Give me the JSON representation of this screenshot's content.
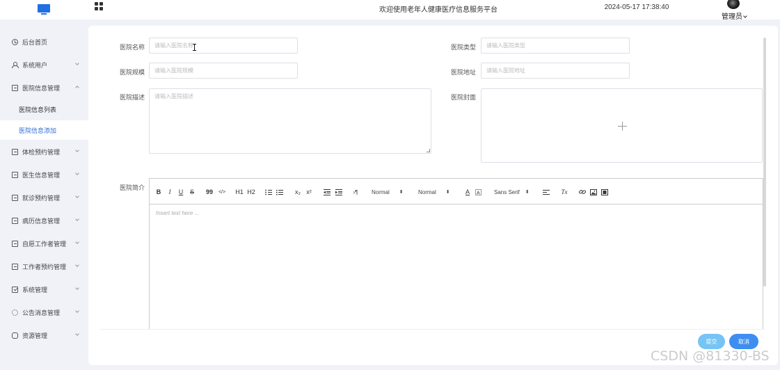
{
  "header": {
    "site_title": "欢迎使用老年人健康医疗信息服务平台",
    "datetime": "2024-05-17 17:38:40",
    "user": "管理员"
  },
  "sidebar": {
    "items": [
      {
        "label": "后台首页",
        "icon": "clock-icon"
      },
      {
        "label": "系统用户",
        "icon": "user-icon"
      },
      {
        "label": "医院信息管理",
        "icon": "list-box-icon",
        "expanded": true,
        "children": [
          {
            "label": "医院信息列表",
            "active": false
          },
          {
            "label": "医院信息添加",
            "active": true
          }
        ]
      },
      {
        "label": "体检预约管理",
        "icon": "list-box-icon"
      },
      {
        "label": "医生信息管理",
        "icon": "list-box-icon"
      },
      {
        "label": "就诊预约管理",
        "icon": "list-box-icon"
      },
      {
        "label": "病历信息管理",
        "icon": "list-box-icon"
      },
      {
        "label": "自愿工作者管理",
        "icon": "list-box-icon"
      },
      {
        "label": "工作者预约管理",
        "icon": "list-box-icon"
      },
      {
        "label": "系统管理",
        "icon": "checkbox-icon"
      },
      {
        "label": "公告消息管理",
        "icon": "sun-icon"
      },
      {
        "label": "资源管理",
        "icon": "chat-icon"
      }
    ]
  },
  "form": {
    "name": {
      "label": "医院名称",
      "value": "",
      "placeholder": "请输入医院名称"
    },
    "type": {
      "label": "医院类型",
      "value": "",
      "placeholder": "请输入医院类型"
    },
    "scale": {
      "label": "医院规模",
      "value": "",
      "placeholder": "请输入医院规模"
    },
    "address": {
      "label": "医院地址",
      "value": "",
      "placeholder": "请输入医院地址"
    },
    "description": {
      "label": "医院描述",
      "value": "",
      "placeholder": "请输入医院描述"
    },
    "cover": {
      "label": "医院封面"
    },
    "intro": {
      "label": "医院简介",
      "placeholder": "Insert text here ..."
    }
  },
  "editor_toolbar": {
    "bold": "B",
    "italic": "I",
    "underline": "U",
    "strike": "S",
    "blockquote": "99",
    "code": "</>",
    "h1": "H1",
    "h2": "H2",
    "sub": "x₂",
    "sup": "x²",
    "rtl": "›¶",
    "size_value": "Normal",
    "header_value": "Normal",
    "font_value": "Sans Serif",
    "clean": "Tx"
  },
  "buttons": {
    "submit": "提交",
    "cancel": "取消"
  },
  "watermark": "CSDN @81330-BS",
  "colors": {
    "accent": "#2d6fd8",
    "submit": "#76c4f4",
    "cancel": "#3d8ef0"
  }
}
